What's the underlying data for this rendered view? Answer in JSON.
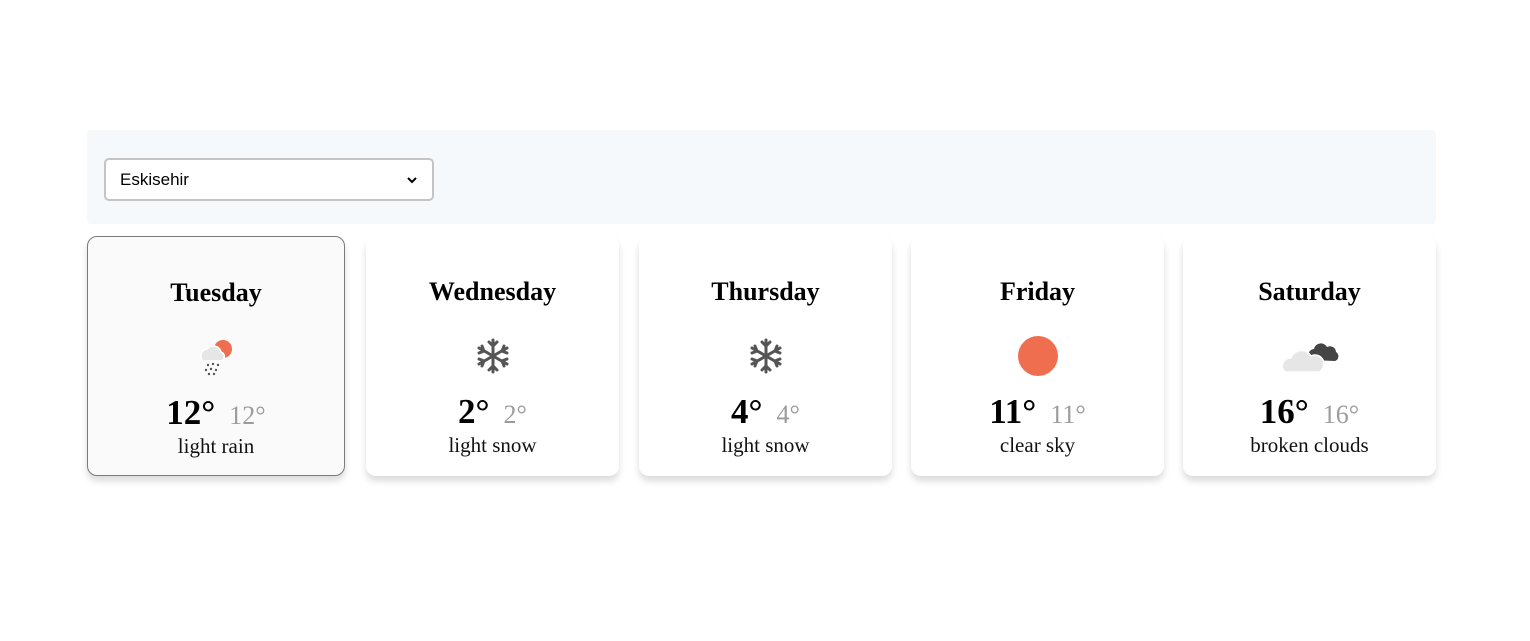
{
  "city_select": {
    "selected": "Eskisehir"
  },
  "colors": {
    "sun": "#ee6e4f",
    "snow": "#555555",
    "cloud_dark": "#444444",
    "cloud_light": "#e6e6e6",
    "muted_temp": "#9c9c9c"
  },
  "forecast": [
    {
      "day": "Tuesday",
      "high": "12°",
      "low": "12°",
      "desc": "light rain",
      "icon": "rain-sun-icon"
    },
    {
      "day": "Wednesday",
      "high": "2°",
      "low": "2°",
      "desc": "light snow",
      "icon": "snowflake-icon"
    },
    {
      "day": "Thursday",
      "high": "4°",
      "low": "4°",
      "desc": "light snow",
      "icon": "snowflake-icon"
    },
    {
      "day": "Friday",
      "high": "11°",
      "low": "11°",
      "desc": "clear sky",
      "icon": "sun-icon"
    },
    {
      "day": "Saturday",
      "high": "16°",
      "low": "16°",
      "desc": "broken clouds",
      "icon": "broken-clouds-icon"
    }
  ]
}
